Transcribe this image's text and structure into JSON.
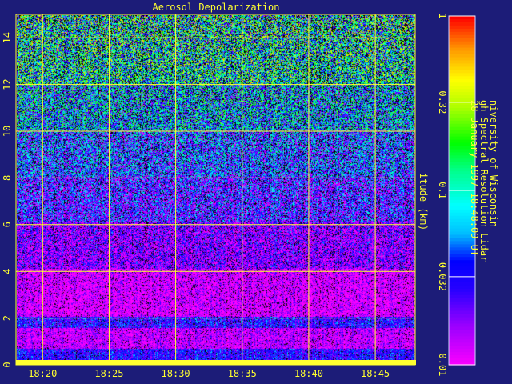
{
  "title": "Aerosol Depolarization",
  "side_text": {
    "y_axis_label": "itude (km)",
    "institution": "niversity of Wisconsin",
    "instrument": "gh Spectral Resolution Lidar",
    "timestamp": "28-January-1997 18:48:09 UT"
  },
  "colors": {
    "background": "#1c1c78",
    "text": "#ffff30",
    "grid": "#ffff30"
  },
  "chart_data": {
    "type": "heatmap",
    "title": "Aerosol Depolarization",
    "ylabel": "itude (km)",
    "xlabel": "",
    "x_ticks": [
      "18:20",
      "18:25",
      "18:30",
      "18:35",
      "18:40",
      "18:45"
    ],
    "y_ticks": [
      "0",
      "2",
      "4",
      "6",
      "8",
      "10",
      "12",
      "14"
    ],
    "ylim": [
      0,
      15
    ],
    "xlim": [
      "18:18",
      "18:48"
    ],
    "grid": true,
    "colorbar": {
      "scale": "log",
      "range": [
        0.01,
        1
      ],
      "tick_labels": [
        "0.01",
        "0.032",
        "0.1",
        "0.32",
        "1"
      ]
    },
    "layers": [
      {
        "alt_range": [
          0,
          0.5
        ],
        "level": 0.03
      },
      {
        "alt_range": [
          0.5,
          1.4
        ],
        "level": 0.013
      },
      {
        "alt_range": [
          1.4,
          1.9
        ],
        "level": 0.03
      },
      {
        "alt_range": [
          1.9,
          4.0
        ],
        "level": 0.011
      },
      {
        "alt_range": [
          4.0,
          6.0
        ],
        "level": 0.018
      },
      {
        "alt_range": [
          6.0,
          8.0
        ],
        "level": 0.028
      },
      {
        "alt_range": [
          8.0,
          10.0
        ],
        "level": 0.04
      },
      {
        "alt_range": [
          10.0,
          12.0
        ],
        "level": 0.06
      },
      {
        "alt_range": [
          12.0,
          15.0
        ],
        "level": 0.1
      }
    ]
  }
}
